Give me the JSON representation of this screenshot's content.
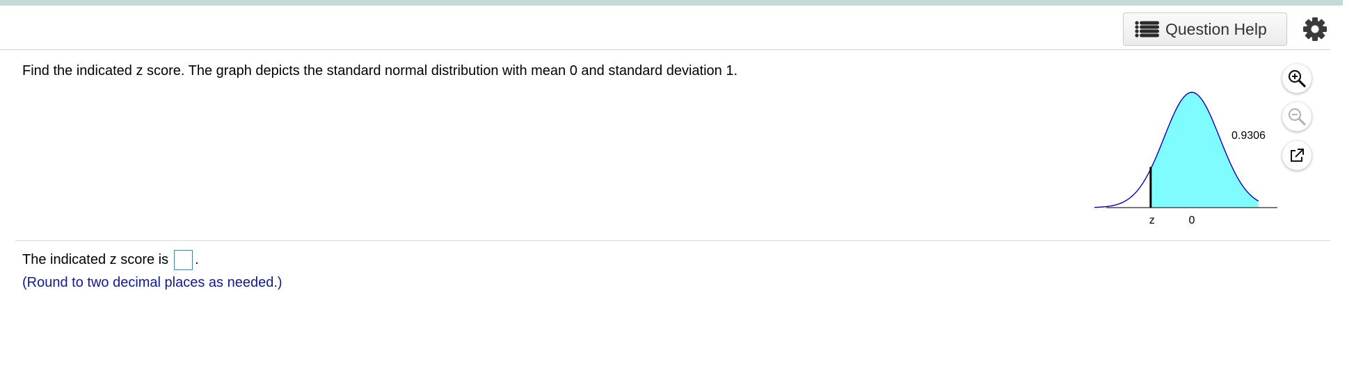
{
  "toolbar": {
    "help_label": "Question Help",
    "help_icon": "list-icon",
    "settings_icon": "gear-icon"
  },
  "question": {
    "prompt": "Find the indicated z score. The graph depicts the standard normal distribution with mean 0 and standard deviation 1."
  },
  "figure": {
    "area_label": "0.9306",
    "z_label": "z",
    "zero_label": "0",
    "shaded_area": 0.9306,
    "z_value": -1.48,
    "shade_color": "#7ffcff",
    "curve_color": "#0000c8"
  },
  "figure_tools": {
    "zoom_in_icon": "zoom-in-icon",
    "zoom_out_icon": "zoom-out-icon",
    "popout_icon": "popout-icon"
  },
  "answer": {
    "prefix": "The indicated z score is",
    "suffix": ".",
    "value": "",
    "hint": "(Round to two decimal places as needed.)"
  },
  "colors": {
    "top_bar": "#c2dbd6",
    "hint_text": "#0e1a8e",
    "input_border": "#4a7fb0"
  }
}
